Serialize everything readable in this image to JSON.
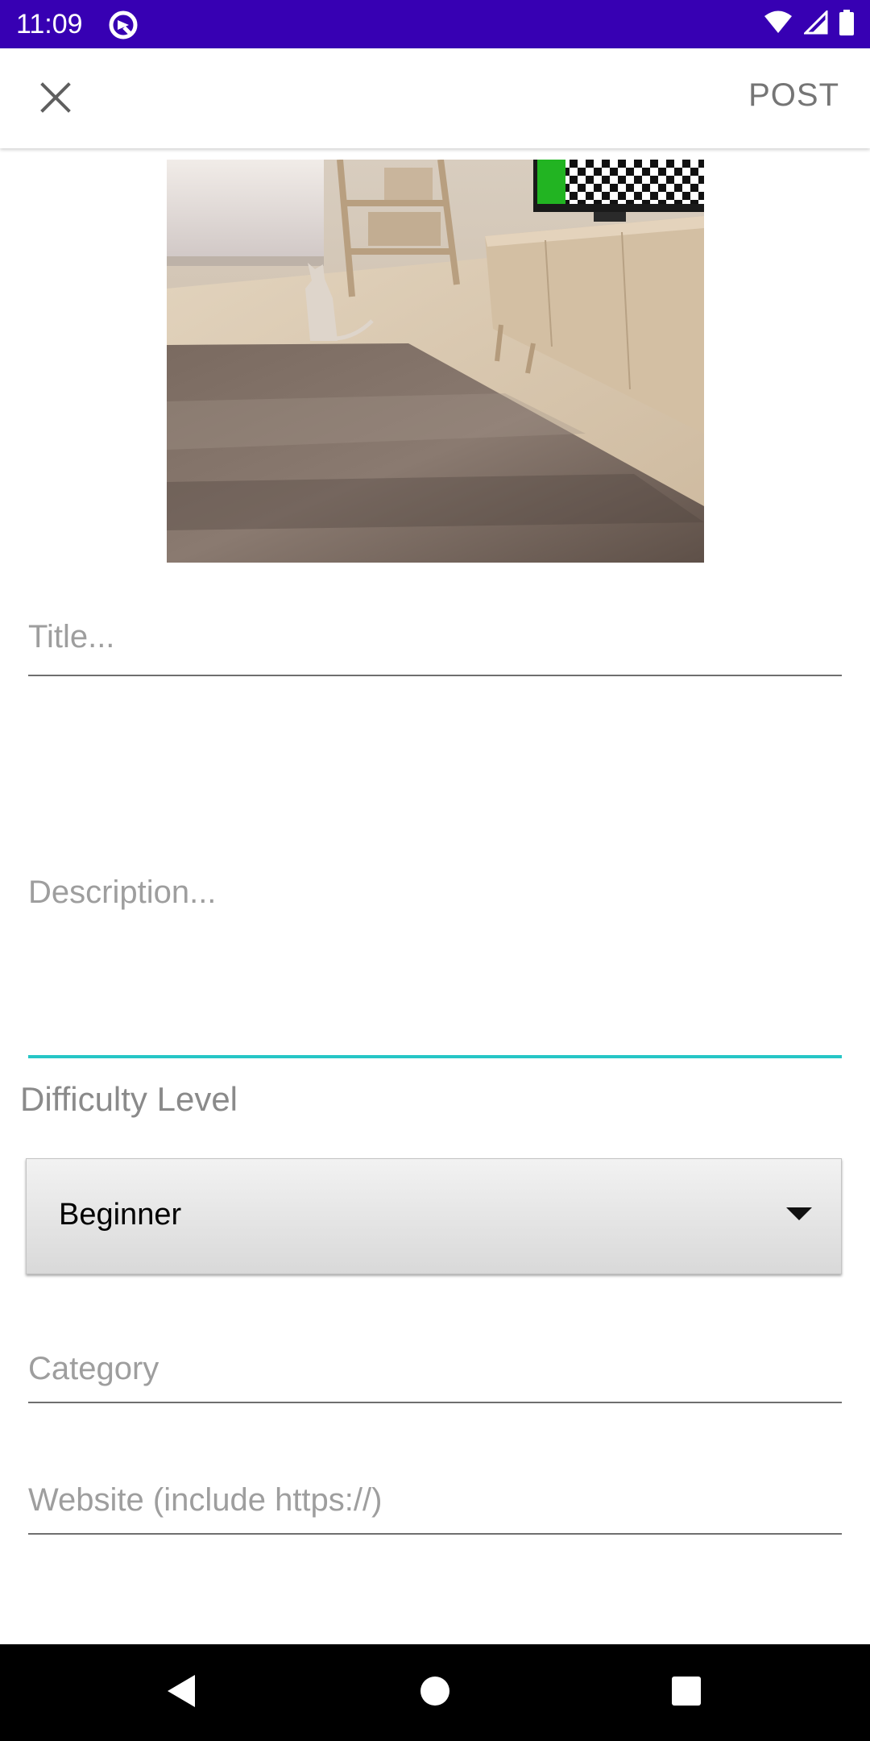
{
  "status_bar": {
    "time": "11:09",
    "bg_color": "#3700b3",
    "icons": [
      "app-notification-icon",
      "wifi-icon",
      "cell-signal-icon",
      "battery-icon"
    ]
  },
  "app_bar": {
    "close_icon": "close-icon",
    "post_label": "POST"
  },
  "photo": {
    "description_icon": "uploaded-photo"
  },
  "form": {
    "title_placeholder": "Title...",
    "description_placeholder": "Description...",
    "difficulty_label": "Difficulty Level",
    "difficulty_selected": "Beginner",
    "category_placeholder": "Category",
    "website_placeholder": "Website (include https://)",
    "focus_color": "#26c6c6"
  },
  "nav_bar": {
    "back_icon": "back-triangle-icon",
    "home_icon": "home-circle-icon",
    "recents_icon": "recents-square-icon"
  }
}
